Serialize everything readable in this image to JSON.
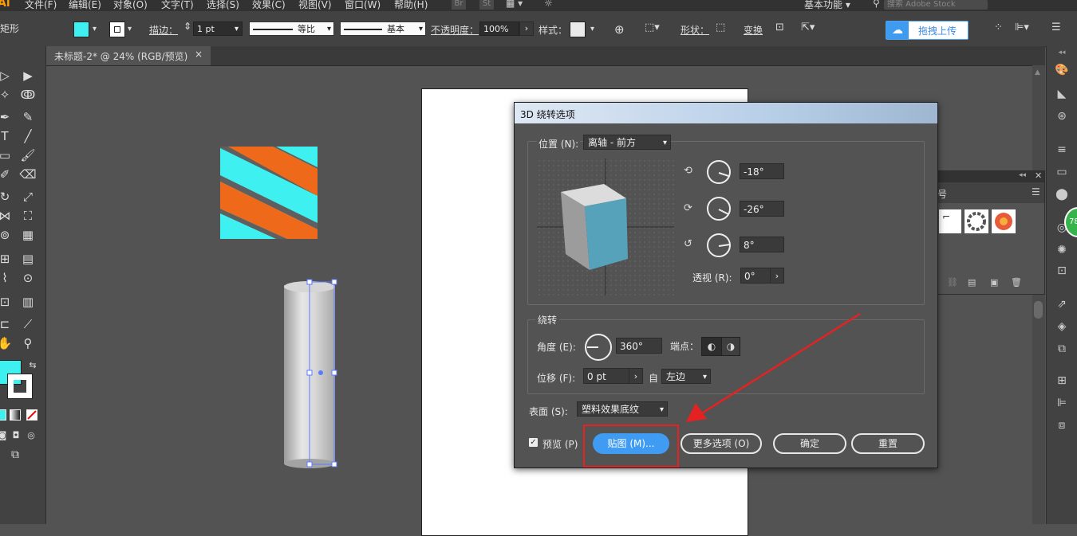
{
  "menu": {
    "app_badge": "Ai",
    "items": [
      "文件(F)",
      "编辑(E)",
      "对象(O)",
      "文字(T)",
      "选择(S)",
      "效果(C)",
      "视图(V)",
      "窗口(W)",
      "帮助(H)"
    ],
    "bridge": "Br",
    "stock": "St",
    "workspace": "基本功能",
    "stock_search_placeholder": "搜索 Adobe Stock"
  },
  "control": {
    "tool_name": "矩形",
    "fill_color": "#3ff0f0",
    "stroke_label": "描边：",
    "stroke_weight": "1 pt",
    "profile_label": "等比",
    "brush_label": "基本",
    "opacity_label": "不透明度：",
    "opacity_value": "100%",
    "style_label": "样式：",
    "shape_label": "形状：",
    "transform_label": "变换",
    "upload_label": "拖拽上传"
  },
  "tab": {
    "title": "未标题-2* @ 24% (RGB/预览)",
    "close": "×"
  },
  "badge_number": "78",
  "symbol_tab_label": "号",
  "dialog": {
    "title": "3D 绕转选项",
    "position_label": "位置 (N):",
    "position_value": "离轴 - 前方",
    "x_rotation": "-18°",
    "y_rotation": "-26°",
    "z_rotation": "8°",
    "perspective_label": "透视 (R):",
    "perspective_value": "0°",
    "revolve_group": "绕转",
    "angle_label": "角度 (E):",
    "angle_value": "360°",
    "cap_label": "端点：",
    "offset_label": "位移 (F):",
    "offset_value": "0 pt",
    "from_label": "自",
    "from_value": "左边",
    "surface_label": "表面 (S):",
    "surface_value": "塑料效果底纹",
    "preview_label": "预览 (P)",
    "map_button": "贴图 (M)...",
    "more_options_button": "更多选项 (O)",
    "ok_button": "确定",
    "reset_button": "重置"
  },
  "colors": {
    "cyan": "#3ff0f0",
    "orange": "#ee6a1a",
    "accent_blue": "#3f9cf2",
    "highlight_red": "#e52222"
  }
}
